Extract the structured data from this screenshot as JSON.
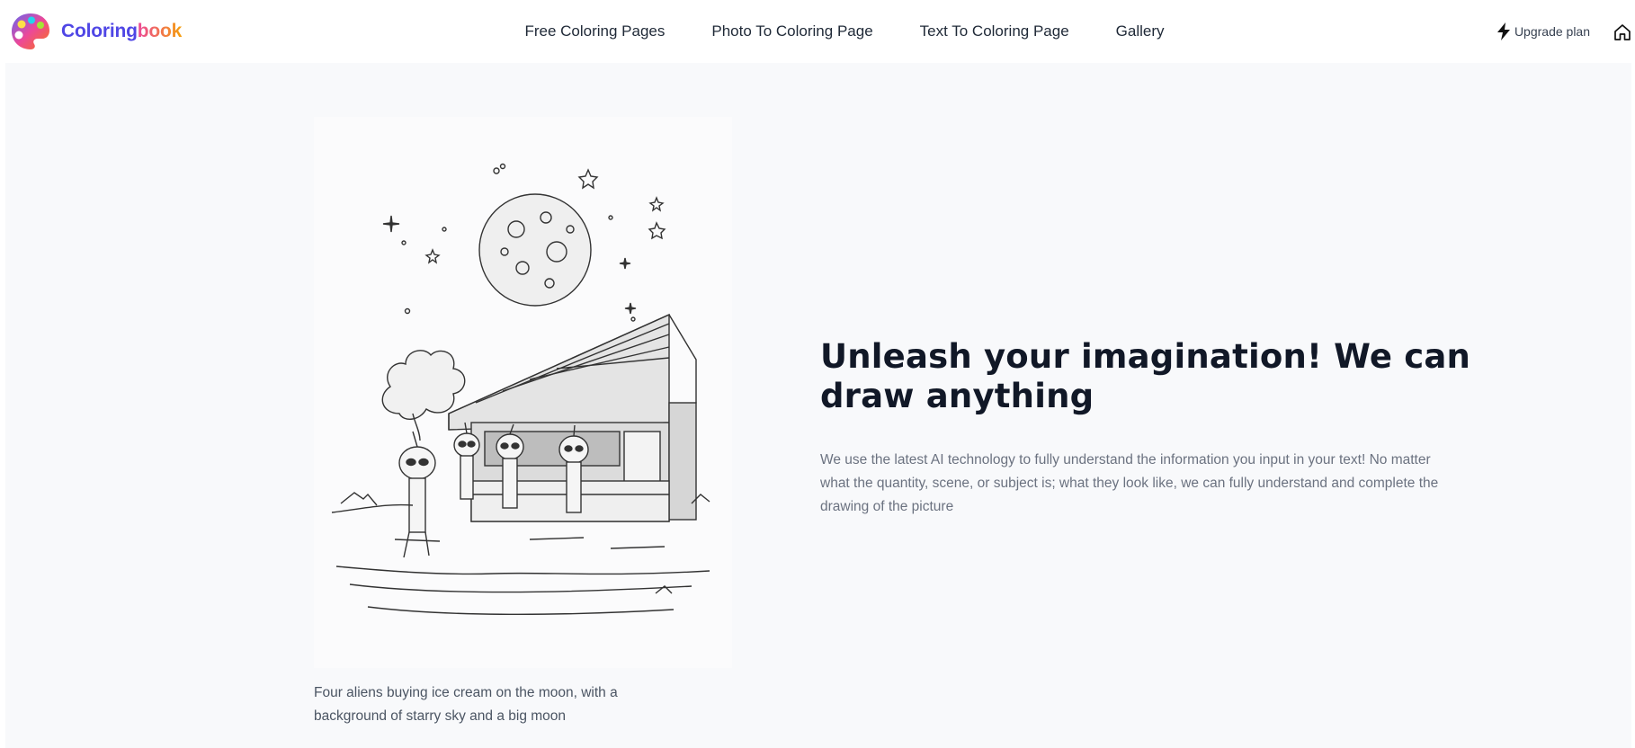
{
  "brand": {
    "name_part1": "Coloring",
    "name_part2": "book"
  },
  "nav": {
    "links": [
      {
        "label": "Free Coloring Pages"
      },
      {
        "label": "Photo To Coloring Page"
      },
      {
        "label": "Text To Coloring Page"
      },
      {
        "label": "Gallery"
      }
    ],
    "upgrade_label": "Upgrade plan",
    "upgrade_icon": "lightning-bolt-icon",
    "home_icon": "home-icon"
  },
  "showcase": {
    "caption": "Four aliens buying ice cream on the moon, with a background of starry sky and a big moon"
  },
  "hero": {
    "title": "Unleash your imagination! We can draw anything",
    "description": "We use the latest AI technology to fully understand the information you input in your text! No matter what the quantity, scene, or subject is; what they look like, we can fully understand and complete the drawing of the picture"
  },
  "colors": {
    "brand_primary": "#4f46e5",
    "brand_gradient_start": "#ec4899",
    "brand_gradient_end": "#f59e0b",
    "page_background": "#f8f9fb"
  }
}
